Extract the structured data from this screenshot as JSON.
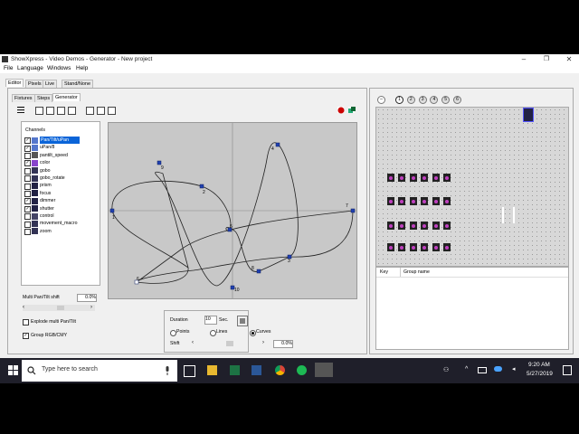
{
  "window": {
    "title": "ShowXpress - Video Demos - Generator - New project"
  },
  "menu": [
    "File",
    "Language",
    "Windows",
    "Help"
  ],
  "main_tabs": [
    "Editor",
    "Pixels",
    "Live",
    "Stand/None"
  ],
  "sub_tabs": [
    "Fixtures",
    "Steps",
    "Generator"
  ],
  "channels": {
    "title": "Channels",
    "items": [
      {
        "label": "Pan/Tilt/uPan",
        "checked": true
      },
      {
        "label": "uPan/8",
        "checked": true
      },
      {
        "label": "pantilt_speed",
        "checked": false
      },
      {
        "label": "color",
        "checked": true
      },
      {
        "label": "gobo",
        "checked": false
      },
      {
        "label": "gobo_rotate",
        "checked": false
      },
      {
        "label": "prism",
        "checked": false
      },
      {
        "label": "focus",
        "checked": false
      },
      {
        "label": "dimmer",
        "checked": true
      },
      {
        "label": "shutter",
        "checked": true
      },
      {
        "label": "control",
        "checked": false
      },
      {
        "label": "movement_macro",
        "checked": false
      },
      {
        "label": "zoom",
        "checked": false
      }
    ]
  },
  "multi_shift": {
    "label": "Multi Pan/Tilt shift",
    "value": "0.0%"
  },
  "explode": {
    "label": "Explode multi Pan/Tilt",
    "checked": false
  },
  "group_rgb": {
    "label": "Group RGB/CMY",
    "checked": true
  },
  "generator": {
    "duration_label": "Duration",
    "duration_value": "10",
    "duration_unit": "Sec.",
    "modes": [
      "Points",
      "Lines",
      "Curves"
    ],
    "selected_mode": "Curves",
    "shift_label": "Shift",
    "shift_value": "0.0%"
  },
  "point_labels": [
    "1",
    "2",
    "3",
    "4",
    "5",
    "6",
    "7",
    "8",
    "9",
    "10"
  ],
  "preview_tabs": [
    "1",
    "2",
    "3",
    "4",
    "5",
    "6"
  ],
  "groups_table": {
    "col_key": "Key",
    "col_name": "Group name"
  },
  "taskbar": {
    "search_placeholder": "Type here to search",
    "time": "9:20 AM",
    "date": "5/27/2019"
  }
}
